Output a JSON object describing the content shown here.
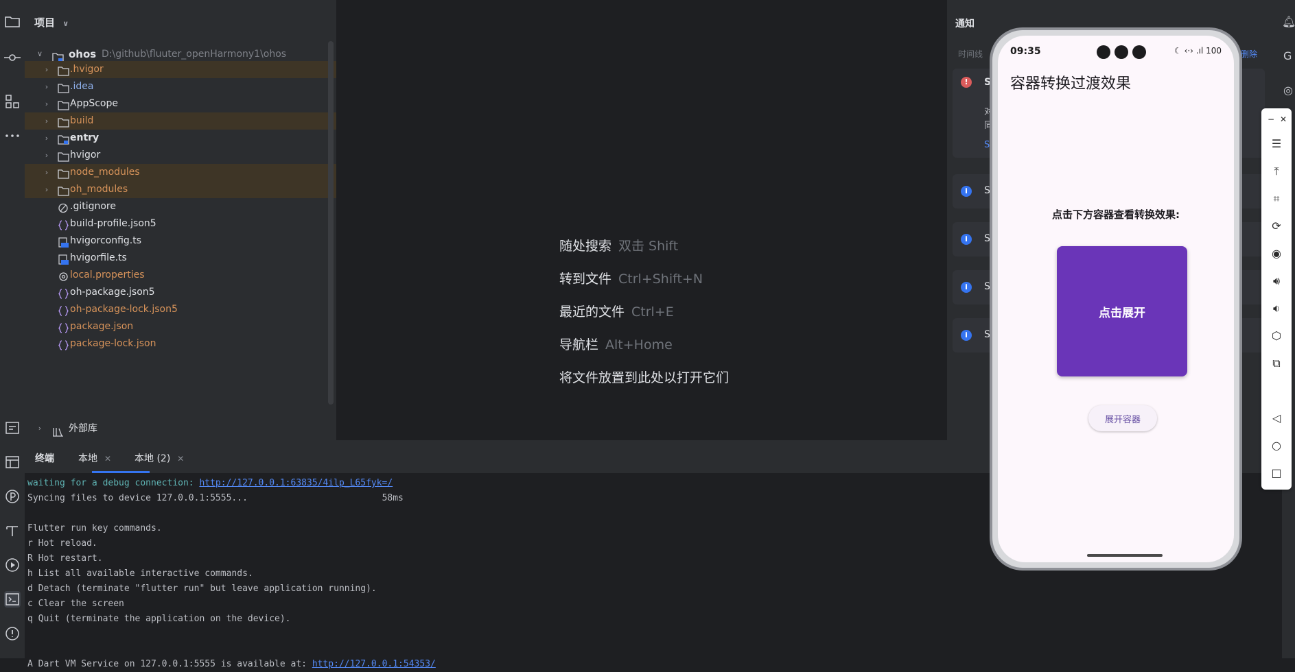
{
  "project_panel": {
    "header": "项目",
    "root": {
      "name": "ohos",
      "path": "D:\\github\\fluuter_openHarmony1\\ohos"
    },
    "items": [
      {
        "label": ".hvigor",
        "kind": "folder",
        "highlight": true,
        "expandable": true
      },
      {
        "label": ".idea",
        "kind": "folder",
        "highlight": false,
        "expandable": true
      },
      {
        "label": "AppScope",
        "kind": "folder",
        "highlight": false,
        "expandable": true
      },
      {
        "label": "build",
        "kind": "folder",
        "highlight": true,
        "expandable": true
      },
      {
        "label": "entry",
        "kind": "module",
        "highlight": false,
        "expandable": true
      },
      {
        "label": "hvigor",
        "kind": "folder",
        "highlight": false,
        "expandable": true
      },
      {
        "label": "node_modules",
        "kind": "folder",
        "highlight": true,
        "expandable": true
      },
      {
        "label": "oh_modules",
        "kind": "folder",
        "highlight": true,
        "expandable": true
      },
      {
        "label": ".gitignore",
        "kind": "ignore-file",
        "highlight": false,
        "expandable": false
      },
      {
        "label": "build-profile.json5",
        "kind": "json-file",
        "highlight": false,
        "expandable": false
      },
      {
        "label": "hvigorconfig.ts",
        "kind": "ts-file",
        "highlight": false,
        "expandable": false
      },
      {
        "label": "hvigorfile.ts",
        "kind": "ts-file",
        "highlight": false,
        "expandable": false
      },
      {
        "label": "local.properties",
        "kind": "properties-file",
        "highlight": false,
        "expandable": false
      },
      {
        "label": "oh-package.json5",
        "kind": "json-file",
        "highlight": false,
        "expandable": false
      },
      {
        "label": "oh-package-lock.json5",
        "kind": "json-file",
        "highlight": false,
        "expandable": false
      },
      {
        "label": "package.json",
        "kind": "json-file",
        "highlight": false,
        "expandable": false
      },
      {
        "label": "package-lock.json",
        "kind": "json-file",
        "highlight": false,
        "expandable": false
      }
    ],
    "external_libs": "外部库"
  },
  "editor_hints": [
    {
      "label": "随处搜索",
      "key": "双击 Shift"
    },
    {
      "label": "转到文件",
      "key": "Ctrl+Shift+N"
    },
    {
      "label": "最近的文件",
      "key": "Ctrl+E"
    },
    {
      "label": "导航栏",
      "key": "Alt+Home"
    },
    {
      "label": "将文件放置到此处以打开它们",
      "key": ""
    }
  ],
  "notifications": {
    "title": "通知",
    "subheader": "时间线",
    "clear_label": "删除",
    "cards": [
      {
        "icon": "error-icon",
        "title": "Sy",
        "line1": "对",
        "line2": "同",
        "link": "Sy"
      },
      {
        "icon": "info-icon",
        "title": "Sy"
      },
      {
        "icon": "info-icon",
        "title": "Sy"
      },
      {
        "icon": "info-icon",
        "title": "Sy"
      },
      {
        "icon": "info-icon",
        "title": "Sy"
      }
    ]
  },
  "phone": {
    "status_time": "09:35",
    "status_icons": "☾ ‹·› .ıl 100",
    "app_title": "容器转换过渡效果",
    "prompt": "点击下方容器查看转换效果:",
    "container_label": "点击展开",
    "button_label": "展开容器",
    "colors": {
      "container": "#6a35b8",
      "screen_bg": "#fdf7fc",
      "button_text": "#6750a4"
    }
  },
  "terminal": {
    "tabs": [
      {
        "label": "终端",
        "closable": false
      },
      {
        "label": "本地",
        "closable": true,
        "active": true
      },
      {
        "label": "本地 (2)",
        "closable": true
      }
    ],
    "waiting_prefix": "waiting for a debug connection: ",
    "waiting_link": "http://127.0.0.1:63835/4ilp_L65fyk=/",
    "syncing": "Syncing files to device 127.0.0.1:5555...",
    "syncing_time": "58ms",
    "lines": [
      "",
      "Flutter run key commands.",
      "r Hot reload.",
      "R Hot restart.",
      "h List all available interactive commands.",
      "d Detach (terminate \"flutter run\" but leave application running).",
      "c Clear the screen",
      "q Quit (terminate the application on the device).",
      ""
    ],
    "vm_prefix": "A Dart VM Service on 127.0.0.1:5555 is available at: ",
    "vm_link": "http://127.0.0.1:54353/"
  }
}
